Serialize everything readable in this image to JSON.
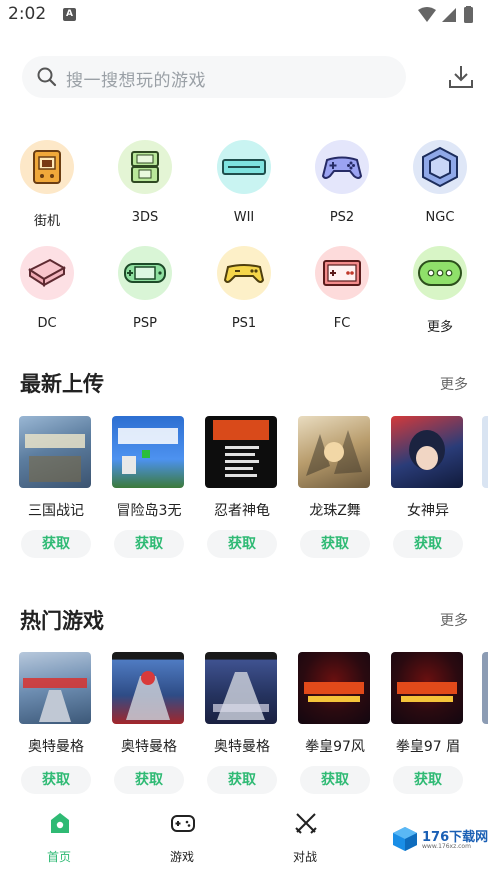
{
  "status": {
    "time": "2:02",
    "notif": "A"
  },
  "search": {
    "placeholder": "搜一搜想玩的游戏"
  },
  "platforms": [
    {
      "label": "街机",
      "icon": "arcade-icon",
      "bg": "#fde8c8"
    },
    {
      "label": "3DS",
      "icon": "3ds-icon",
      "bg": "#e4f5d5"
    },
    {
      "label": "WII",
      "icon": "wii-icon",
      "bg": "#c9f4f2"
    },
    {
      "label": "PS2",
      "icon": "gamepad-icon",
      "bg": "#e4e6fb"
    },
    {
      "label": "NGC",
      "icon": "gamecube-icon",
      "bg": "#dfe7f7"
    },
    {
      "label": "DC",
      "icon": "dreamcast-icon",
      "bg": "#fde0e4"
    },
    {
      "label": "PSP",
      "icon": "psp-icon",
      "bg": "#d9f5d6"
    },
    {
      "label": "PS1",
      "icon": "ps1-controller-icon",
      "bg": "#fdf0c8"
    },
    {
      "label": "FC",
      "icon": "famicom-icon",
      "bg": "#fddbdb"
    },
    {
      "label": "更多",
      "icon": "more-icon",
      "bg": "#d8f5c6"
    }
  ],
  "latest": {
    "title": "最新上传",
    "more": "更多",
    "games": [
      {
        "name": "三国战记",
        "button": "获取",
        "cover": "#6a8cb0"
      },
      {
        "name": "冒险岛3无",
        "button": "获取",
        "cover": "#3d7fd8"
      },
      {
        "name": "忍者神龟",
        "button": "获取",
        "cover": "#111111"
      },
      {
        "name": "龙珠Z舞",
        "button": "获取",
        "cover": "#c8b48a"
      },
      {
        "name": "女神异",
        "button": "获取",
        "cover": "#2a3c78"
      }
    ]
  },
  "hot": {
    "title": "热门游戏",
    "more": "更多",
    "games": [
      {
        "name": "奥特曼格",
        "button": "获取",
        "cover": "#5b7fa8"
      },
      {
        "name": "奥特曼格",
        "button": "获取",
        "cover": "#2f4f8a"
      },
      {
        "name": "奥特曼格",
        "button": "获取",
        "cover": "#25335f"
      },
      {
        "name": "拳皇97风",
        "button": "获取",
        "cover": "#1a0d1a"
      },
      {
        "name": "拳皇97 眉",
        "button": "获取",
        "cover": "#1a0d1a"
      }
    ]
  },
  "tabs": [
    {
      "label": "首页",
      "icon": "home-icon",
      "active": true
    },
    {
      "label": "游戏",
      "icon": "gamepad-icon",
      "active": false
    },
    {
      "label": "对战",
      "icon": "swords-icon",
      "active": false
    }
  ],
  "watermark": {
    "text": "176下载网",
    "sub": "www.176xz.com"
  },
  "colors": {
    "accent": "#2fba74"
  }
}
